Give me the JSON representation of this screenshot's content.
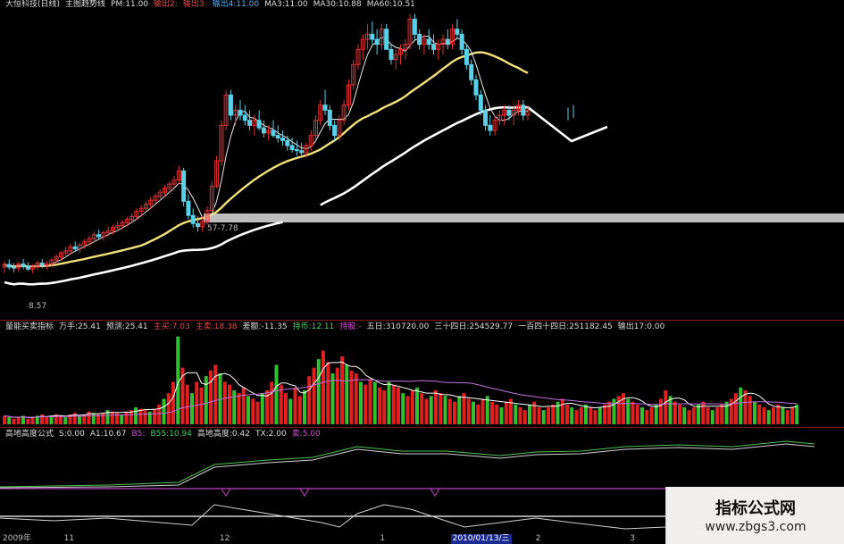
{
  "header": {
    "items": [
      {
        "text": "大恒科技(日线)",
        "color": "#dddddd"
      },
      {
        "text": "主图趋势线",
        "color": "#dddddd"
      },
      {
        "text": "PM:11.00",
        "color": "#dddddd"
      },
      {
        "text": "输出2:",
        "color": "#e04a4a"
      },
      {
        "text": "输出3:",
        "color": "#e04a4a"
      },
      {
        "text": "输出4:11.00",
        "color": "#4ab0ff"
      },
      {
        "text": "MA3:11.00",
        "color": "#dddddd"
      },
      {
        "text": "MA30:10.88",
        "color": "#dddddd"
      },
      {
        "text": "MA60:10.51",
        "color": "#dddddd"
      }
    ]
  },
  "indicator1": {
    "items": [
      {
        "text": "量能买卖指标",
        "color": "#dddddd"
      },
      {
        "text": "万手:25.41",
        "color": "#dddddd"
      },
      {
        "text": "预测:25.41",
        "color": "#dddddd"
      },
      {
        "text": "主买:7.03",
        "color": "#e04a4a"
      },
      {
        "text": "主卖:18.38",
        "color": "#e04a4a"
      },
      {
        "text": "差额:-11.35",
        "color": "#dddddd"
      },
      {
        "text": "持币:12.11",
        "color": "#40d060"
      },
      {
        "text": "持股:-",
        "color": "#d050d0"
      },
      {
        "text": "五日:310720.00",
        "color": "#dddddd"
      },
      {
        "text": "三十四日:254529.77",
        "color": "#dddddd"
      },
      {
        "text": "一百四十四日:251182.45",
        "color": "#dddddd"
      },
      {
        "text": "输出17:0.00",
        "color": "#dddddd"
      }
    ]
  },
  "indicator2": {
    "items": [
      {
        "text": "高地高度公式",
        "color": "#dddddd"
      },
      {
        "text": "S:0.00",
        "color": "#dddddd"
      },
      {
        "text": "A1:10.67",
        "color": "#dddddd"
      },
      {
        "text": "B5:",
        "color": "#d050d0"
      },
      {
        "text": "B55:10.94",
        "color": "#40d060"
      },
      {
        "text": "高地高度:0.42",
        "color": "#dddddd"
      },
      {
        "text": "TX:2.00",
        "color": "#dddddd"
      },
      {
        "text": "卖:5.00",
        "color": "#d050d0"
      }
    ]
  },
  "price_labels": {
    "high_band": "57-7.78",
    "low": "8.57"
  },
  "time_axis": [
    {
      "label": "2009年",
      "day": 0
    },
    {
      "label": "11",
      "day": 13
    },
    {
      "label": "12",
      "day": 46
    },
    {
      "label": "1",
      "day": 80
    },
    {
      "label": "2010/01/13/三",
      "day": 95
    },
    {
      "label": "2",
      "day": 113
    },
    {
      "label": "3",
      "day": 133
    }
  ],
  "watermark": {
    "title": "指标公式网",
    "url": "www.zbgs3.com"
  },
  "colors": {
    "up": "#e03030",
    "down": "#5ad0e8",
    "ma_yellow": "#f2e07a",
    "ma_white": "#ffffff",
    "vol_up": "#e02020",
    "vol_down": "#30c030",
    "band": "#bdbdbd",
    "separator": "#7a1a1a"
  },
  "chart_data": {
    "type": "candlestick",
    "days": 176,
    "price_range": [
      7.5,
      13.5
    ],
    "ohlc": [
      [
        8.4,
        8.52,
        8.28,
        8.45
      ],
      [
        8.45,
        8.55,
        8.35,
        8.4
      ],
      [
        8.4,
        8.48,
        8.3,
        8.38
      ],
      [
        8.38,
        8.5,
        8.3,
        8.46
      ],
      [
        8.46,
        8.56,
        8.36,
        8.42
      ],
      [
        8.42,
        8.5,
        8.32,
        8.36
      ],
      [
        8.36,
        8.46,
        8.28,
        8.4
      ],
      [
        8.4,
        8.52,
        8.34,
        8.48
      ],
      [
        8.48,
        8.56,
        8.38,
        8.44
      ],
      [
        8.44,
        8.52,
        8.36,
        8.46
      ],
      [
        8.46,
        8.58,
        8.4,
        8.54
      ],
      [
        8.54,
        8.66,
        8.46,
        8.6
      ],
      [
        8.6,
        8.72,
        8.52,
        8.68
      ],
      [
        8.68,
        8.8,
        8.58,
        8.72
      ],
      [
        8.72,
        8.86,
        8.64,
        8.8
      ],
      [
        8.8,
        8.9,
        8.7,
        8.76
      ],
      [
        8.76,
        8.88,
        8.68,
        8.84
      ],
      [
        8.84,
        8.96,
        8.76,
        8.9
      ],
      [
        8.9,
        9.02,
        8.82,
        8.96
      ],
      [
        8.96,
        9.1,
        8.88,
        9.04
      ],
      [
        9.04,
        9.14,
        8.96,
        9.0
      ],
      [
        9.0,
        9.12,
        8.92,
        9.08
      ],
      [
        9.08,
        9.2,
        9.0,
        9.12
      ],
      [
        9.12,
        9.24,
        9.04,
        9.18
      ],
      [
        9.18,
        9.3,
        9.1,
        9.22
      ],
      [
        9.22,
        9.34,
        9.14,
        9.28
      ],
      [
        9.28,
        9.4,
        9.2,
        9.34
      ],
      [
        9.34,
        9.46,
        9.26,
        9.4
      ],
      [
        9.4,
        9.56,
        9.32,
        9.5
      ],
      [
        9.5,
        9.62,
        9.42,
        9.56
      ],
      [
        9.56,
        9.7,
        9.48,
        9.64
      ],
      [
        9.64,
        9.78,
        9.56,
        9.72
      ],
      [
        9.72,
        9.86,
        9.64,
        9.8
      ],
      [
        9.8,
        9.94,
        9.7,
        9.88
      ],
      [
        9.88,
        10.02,
        9.8,
        9.96
      ],
      [
        9.96,
        10.1,
        9.88,
        10.04
      ],
      [
        10.04,
        10.2,
        9.96,
        10.12
      ],
      [
        10.12,
        10.4,
        10.04,
        10.3
      ],
      [
        10.3,
        10.36,
        9.6,
        9.7
      ],
      [
        9.7,
        9.84,
        9.34,
        9.42
      ],
      [
        9.42,
        9.56,
        9.18,
        9.26
      ],
      [
        9.26,
        9.4,
        9.1,
        9.2
      ],
      [
        9.2,
        9.4,
        9.1,
        9.3
      ],
      [
        9.3,
        9.6,
        9.24,
        9.52
      ],
      [
        9.52,
        10.1,
        9.48,
        10.0
      ],
      [
        10.0,
        10.6,
        9.96,
        10.5
      ],
      [
        10.5,
        11.3,
        10.4,
        11.2
      ],
      [
        11.2,
        11.9,
        11.1,
        11.8
      ],
      [
        11.8,
        11.9,
        11.3,
        11.4
      ],
      [
        11.4,
        11.6,
        11.2,
        11.5
      ],
      [
        11.5,
        11.7,
        11.3,
        11.4
      ],
      [
        11.4,
        11.6,
        11.2,
        11.3
      ],
      [
        11.3,
        11.5,
        11.1,
        11.2
      ],
      [
        11.2,
        11.4,
        11.0,
        11.3
      ],
      [
        11.3,
        11.5,
        11.1,
        11.15
      ],
      [
        11.15,
        11.3,
        10.96,
        11.05
      ],
      [
        11.05,
        11.2,
        10.9,
        11.1
      ],
      [
        11.1,
        11.3,
        10.96,
        11.0
      ],
      [
        11.0,
        11.2,
        10.86,
        10.95
      ],
      [
        10.95,
        11.1,
        10.8,
        10.9
      ],
      [
        10.9,
        11.0,
        10.7,
        10.8
      ],
      [
        10.8,
        10.96,
        10.66,
        10.72
      ],
      [
        10.72,
        10.9,
        10.6,
        10.7
      ],
      [
        10.7,
        10.86,
        10.56,
        10.66
      ],
      [
        10.66,
        10.86,
        10.56,
        10.8
      ],
      [
        10.8,
        11.1,
        10.7,
        11.0
      ],
      [
        11.0,
        11.4,
        10.9,
        11.3
      ],
      [
        11.3,
        11.7,
        11.2,
        11.6
      ],
      [
        11.6,
        11.9,
        11.4,
        11.5
      ],
      [
        11.5,
        11.6,
        11.1,
        11.2
      ],
      [
        11.2,
        11.3,
        10.9,
        11.0
      ],
      [
        11.0,
        11.4,
        10.9,
        11.3
      ],
      [
        11.3,
        11.7,
        11.2,
        11.6
      ],
      [
        11.6,
        12.1,
        11.5,
        12.0
      ],
      [
        12.0,
        12.5,
        11.9,
        12.4
      ],
      [
        12.4,
        12.8,
        12.3,
        12.7
      ],
      [
        12.7,
        13.0,
        12.5,
        12.9
      ],
      [
        12.9,
        13.2,
        12.7,
        13.0
      ],
      [
        13.0,
        13.25,
        12.8,
        12.9
      ],
      [
        12.9,
        13.1,
        12.6,
        12.8
      ],
      [
        12.8,
        13.2,
        12.7,
        13.1
      ],
      [
        13.1,
        13.2,
        12.8,
        12.7
      ],
      [
        12.7,
        12.8,
        12.4,
        12.5
      ],
      [
        12.5,
        12.7,
        12.3,
        12.6
      ],
      [
        12.6,
        12.8,
        12.4,
        12.7
      ],
      [
        12.7,
        12.9,
        12.5,
        12.8
      ],
      [
        12.8,
        13.4,
        12.7,
        13.3
      ],
      [
        13.3,
        13.4,
        12.9,
        13.0
      ],
      [
        13.0,
        13.1,
        12.7,
        12.8
      ],
      [
        12.8,
        13.0,
        12.6,
        12.9
      ],
      [
        12.9,
        13.1,
        12.7,
        12.8
      ],
      [
        12.8,
        13.0,
        12.6,
        12.7
      ],
      [
        12.7,
        12.9,
        12.5,
        12.8
      ],
      [
        12.8,
        13.0,
        12.6,
        12.9
      ],
      [
        12.9,
        13.1,
        12.7,
        12.8
      ],
      [
        12.8,
        13.2,
        12.7,
        13.1
      ],
      [
        13.1,
        13.3,
        12.9,
        13.0
      ],
      [
        13.0,
        13.1,
        12.6,
        12.7
      ],
      [
        12.7,
        12.8,
        12.3,
        12.4
      ],
      [
        12.4,
        12.5,
        12.0,
        12.1
      ],
      [
        12.1,
        12.2,
        11.7,
        11.8
      ],
      [
        11.8,
        11.9,
        11.4,
        11.5
      ],
      [
        11.5,
        11.6,
        11.1,
        11.2
      ],
      [
        11.2,
        11.4,
        11.0,
        11.1
      ],
      [
        11.1,
        11.4,
        11.0,
        11.3
      ],
      [
        11.3,
        11.5,
        11.2,
        11.4
      ],
      [
        11.4,
        11.6,
        11.2,
        11.5
      ],
      [
        11.5,
        11.6,
        11.3,
        11.4
      ],
      [
        11.4,
        11.6,
        11.2,
        11.5
      ],
      [
        11.5,
        11.7,
        11.4,
        11.6
      ],
      [
        11.6,
        11.7,
        11.3,
        11.4
      ],
      [
        11.4,
        11.6,
        11.3,
        11.5
      ]
    ],
    "late_ohlc": [
      [
        11.4,
        11.55,
        11.3,
        11.45
      ],
      [
        11.45,
        11.6,
        11.35,
        11.4
      ]
    ],
    "volume": [
      6,
      5,
      4,
      5,
      6,
      4,
      5,
      6,
      7,
      5,
      6,
      7,
      6,
      5,
      7,
      8,
      6,
      7,
      9,
      8,
      7,
      8,
      10,
      9,
      8,
      7,
      9,
      10,
      12,
      11,
      10,
      9,
      11,
      14,
      18,
      22,
      30,
      62,
      40,
      28,
      22,
      30,
      26,
      34,
      38,
      42,
      36,
      30,
      28,
      24,
      22,
      26,
      20,
      18,
      16,
      22,
      24,
      30,
      42,
      28,
      22,
      18,
      26,
      20,
      24,
      34,
      40,
      46,
      52,
      44,
      36,
      40,
      48,
      42,
      38,
      36,
      30,
      28,
      32,
      30,
      26,
      24,
      30,
      28,
      26,
      22,
      20,
      24,
      26,
      22,
      18,
      20,
      24,
      22,
      20,
      18,
      16,
      20,
      22,
      18,
      16,
      14,
      18,
      20,
      16,
      14,
      12,
      16,
      18,
      14,
      12,
      10,
      14,
      16,
      12,
      10,
      12,
      14,
      16,
      18,
      14,
      12,
      10,
      12,
      14,
      12,
      10,
      12,
      14,
      16,
      18,
      20,
      22,
      18,
      16,
      14,
      12,
      10,
      12,
      14,
      18,
      24,
      20,
      16,
      14,
      12,
      10,
      12,
      14,
      16,
      12,
      10,
      12,
      14,
      16,
      18,
      22,
      26,
      24,
      20,
      16,
      14,
      12,
      10,
      12,
      14,
      12,
      10,
      12,
      14
    ]
  }
}
